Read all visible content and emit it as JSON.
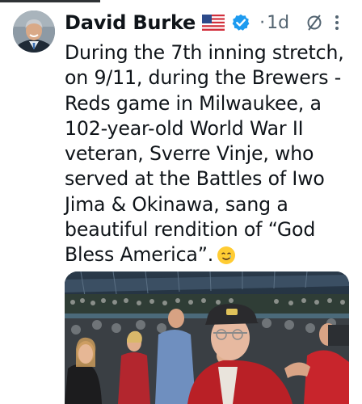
{
  "tweet": {
    "author": "David Burke",
    "flag": "us-flag-emoji",
    "verified_icon": "verified-badge-icon",
    "separator": "·",
    "time": "1d",
    "text": "During the 7th inning stretch, on 9/11, during the Brewers - Reds game in Milwaukee, a 102-year-old World War II veteran, Sverre Vinje, who served at the Battles of Iwo Jima & Okinawa, sang a beautiful rendition of “God Bless America”.",
    "emoji": "tear-smile-emoji"
  },
  "colors": {
    "verified": "#1d9bf0",
    "secondary_text": "#536471",
    "text": "#0f1419"
  }
}
